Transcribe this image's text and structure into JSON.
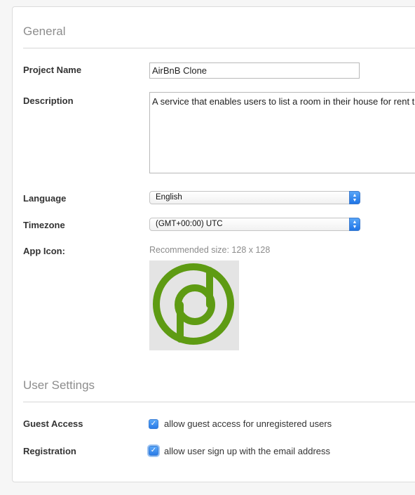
{
  "general": {
    "title": "General",
    "project_name": {
      "label": "Project Name",
      "value": "AirBnB Clone"
    },
    "description": {
      "label": "Description",
      "value": "A service that enables users to list a room in their house for rent t"
    },
    "language": {
      "label": "Language",
      "selected": "English"
    },
    "timezone": {
      "label": "Timezone",
      "selected": "(GMT+00:00) UTC"
    },
    "app_icon": {
      "label": "App Icon:",
      "hint": "Recommended size: 128 x 128",
      "icon": "green-circle-d-logo"
    }
  },
  "user_settings": {
    "title": "User Settings",
    "guest_access": {
      "label": "Guest Access",
      "checkbox_label": "allow guest access for unregistered users",
      "checked": true
    },
    "registration": {
      "label": "Registration",
      "checkbox_label": "allow user sign up with the email address",
      "checked": true
    }
  },
  "colors": {
    "accent": "#2a7be7",
    "logo_green": "#5e9b13"
  }
}
